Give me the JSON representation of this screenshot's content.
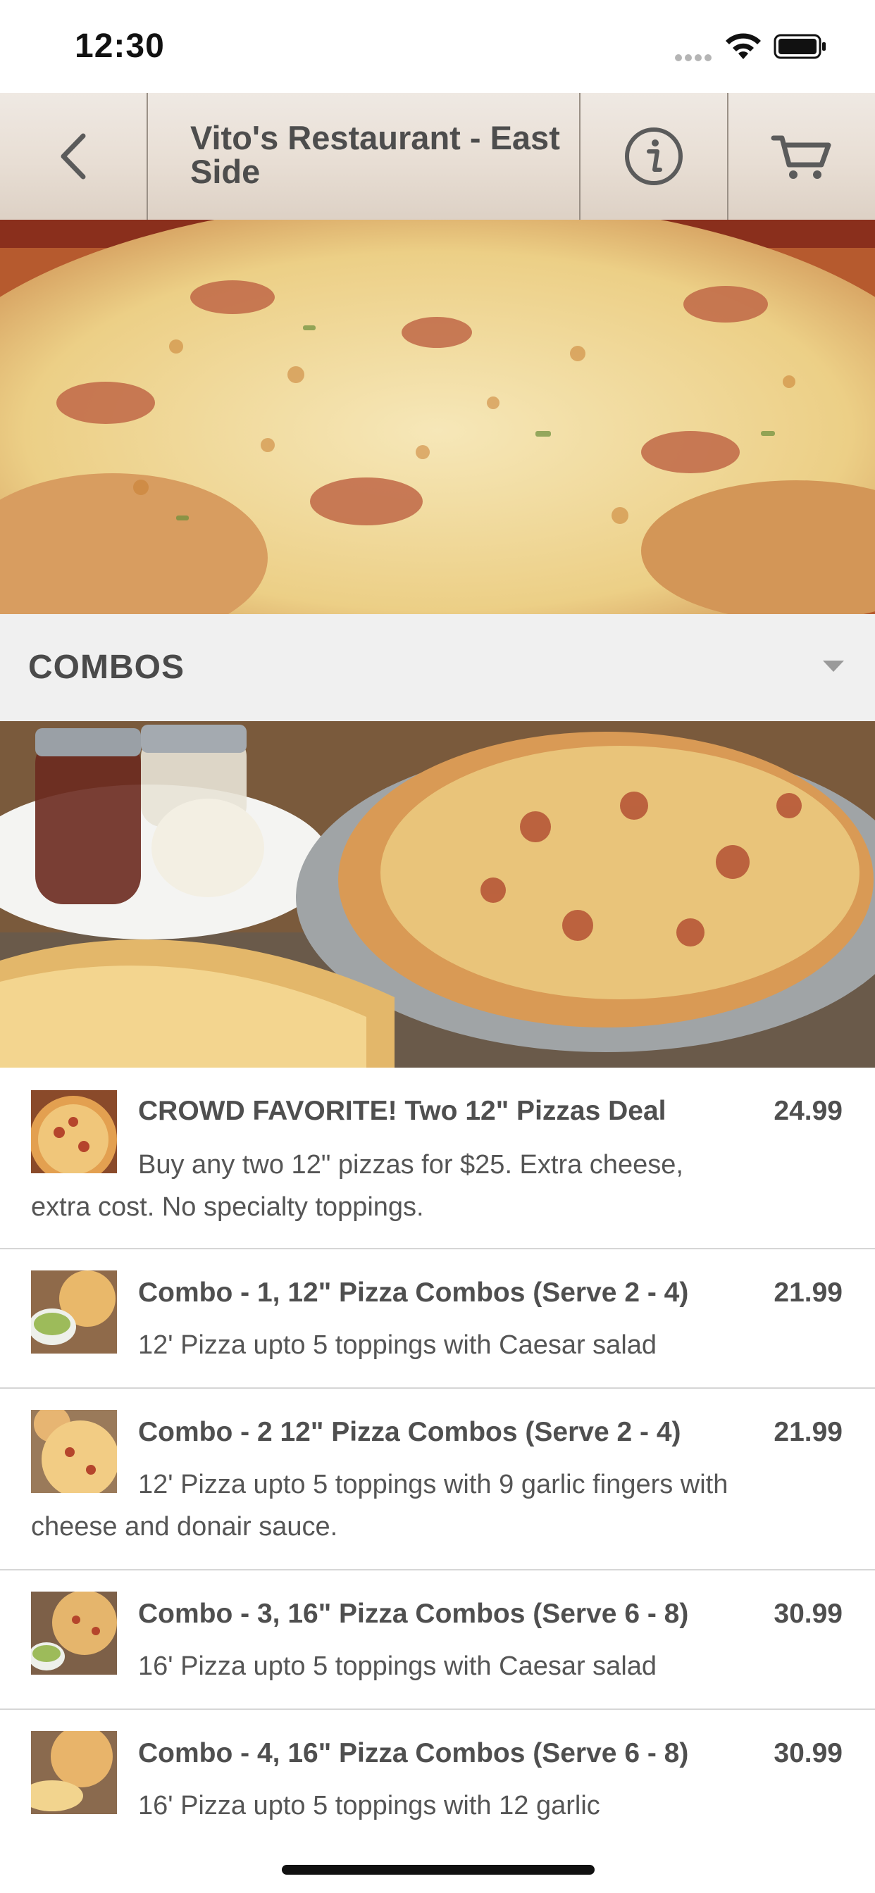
{
  "status_bar": {
    "time": "12:30"
  },
  "header": {
    "title": "Vito's Restaurant - East Side"
  },
  "category": {
    "name": "COMBOS"
  },
  "menu_items": [
    {
      "name": "CROWD FAVORITE! Two 12\" Pizzas Deal",
      "price": "24.99",
      "description": "Buy any two 12\" pizzas for $25. Extra cheese, extra cost. No specialty toppings."
    },
    {
      "name": "Combo - 1, 12\" Pizza Combos (Serve 2 - 4)",
      "price": "21.99",
      "description": "12' Pizza upto 5 toppings with Caesar salad"
    },
    {
      "name": "Combo - 2 12\" Pizza Combos (Serve 2 - 4)",
      "price": "21.99",
      "description": "12' Pizza upto 5 toppings with 9 garlic fingers with cheese and donair sauce."
    },
    {
      "name": "Combo - 3, 16\" Pizza Combos (Serve 6 - 8)",
      "price": "30.99",
      "description": "16' Pizza upto 5 toppings with Caesar salad"
    },
    {
      "name": "Combo - 4, 16\" Pizza Combos (Serve 6 - 8)",
      "price": "30.99",
      "description": "16' Pizza upto 5 toppings with 12 garlic"
    }
  ],
  "icons": {
    "back": "chevron-left-icon",
    "info": "info-icon",
    "cart": "cart-icon",
    "category_toggle": "caret-down-icon"
  }
}
